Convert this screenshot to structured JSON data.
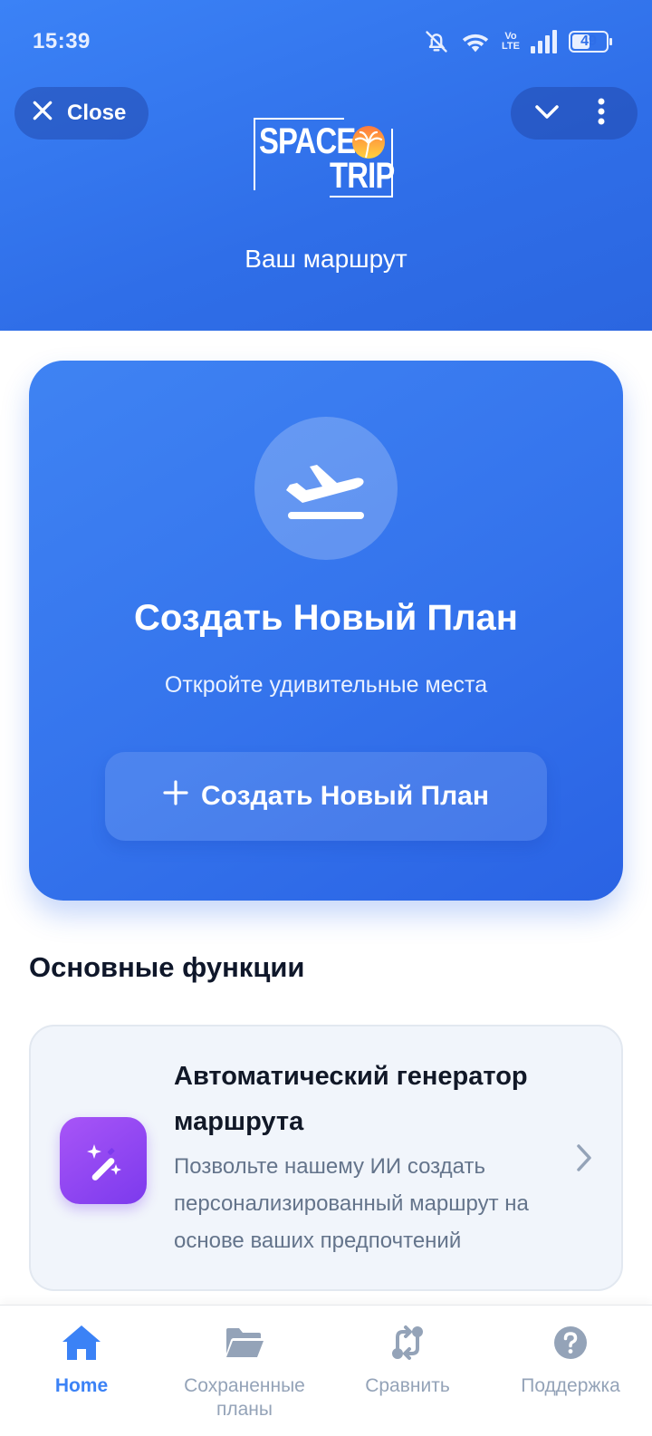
{
  "status_bar": {
    "time": "15:39",
    "network_label_top": "Vo",
    "network_label_bottom": "LTE",
    "battery_level": "49"
  },
  "header": {
    "close_label": "Close",
    "logo_line1": "SPACE",
    "logo_line2": "TRIP",
    "title": "Ваш маршрут"
  },
  "hero": {
    "title": "Создать Новый План",
    "subtitle": "Откройте удивительные места",
    "button_label": "Создать Новый План"
  },
  "features": {
    "section_title": "Основные функции",
    "items": [
      {
        "title": "Автоматический генератор маршрута",
        "description": "Позвольте нашему ИИ создать персонализированный маршрут на основе ваших предпочтений"
      }
    ]
  },
  "bottom_nav": {
    "items": [
      {
        "label": "Home",
        "icon": "home-icon",
        "active": true
      },
      {
        "label": "Сохраненные планы",
        "icon": "folder-icon",
        "active": false
      },
      {
        "label": "Сравнить",
        "icon": "compare-icon",
        "active": false
      },
      {
        "label": "Поддержка",
        "icon": "help-icon",
        "active": false
      }
    ]
  },
  "colors": {
    "primary": "#3b82f6",
    "header_bg": "#2f6ee8",
    "feature_icon": "#8b5cf6",
    "inactive_nav": "#94a3b8"
  }
}
